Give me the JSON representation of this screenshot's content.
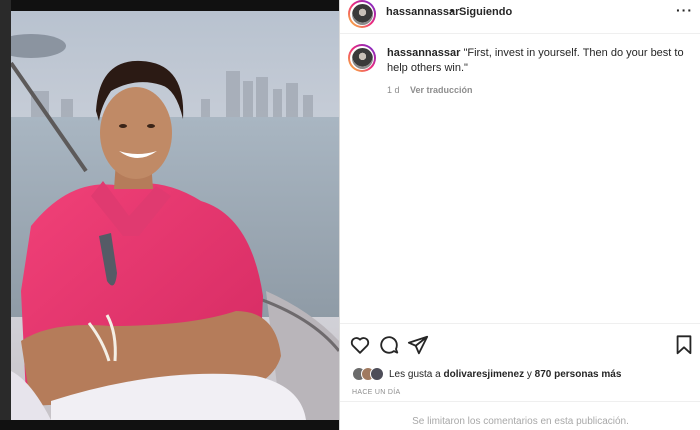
{
  "post": {
    "username": "hassannassar",
    "separator": "•",
    "follow_status": "Siguiendo",
    "more_icon": "more-icon"
  },
  "caption": {
    "username": "hassannassar",
    "text": "\"First, invest in yourself. Then do your best to help others win.\"",
    "age": "1 d",
    "translate_label": "Ver traducción"
  },
  "actions": {
    "icons": [
      "heart-icon",
      "comment-icon",
      "share-icon",
      "save-icon"
    ]
  },
  "likes": {
    "prefix": "Les gusta a",
    "user": "dolivaresjimenez",
    "conj": "y",
    "others": "870 personas más"
  },
  "date": "HACE UN DÍA",
  "comments_limited": "Se limitaron los comentarios en esta publicación.",
  "colors": {
    "text": "#262626",
    "muted": "#8e8e8e",
    "border": "#efefef",
    "shirt": "#e8356f"
  }
}
